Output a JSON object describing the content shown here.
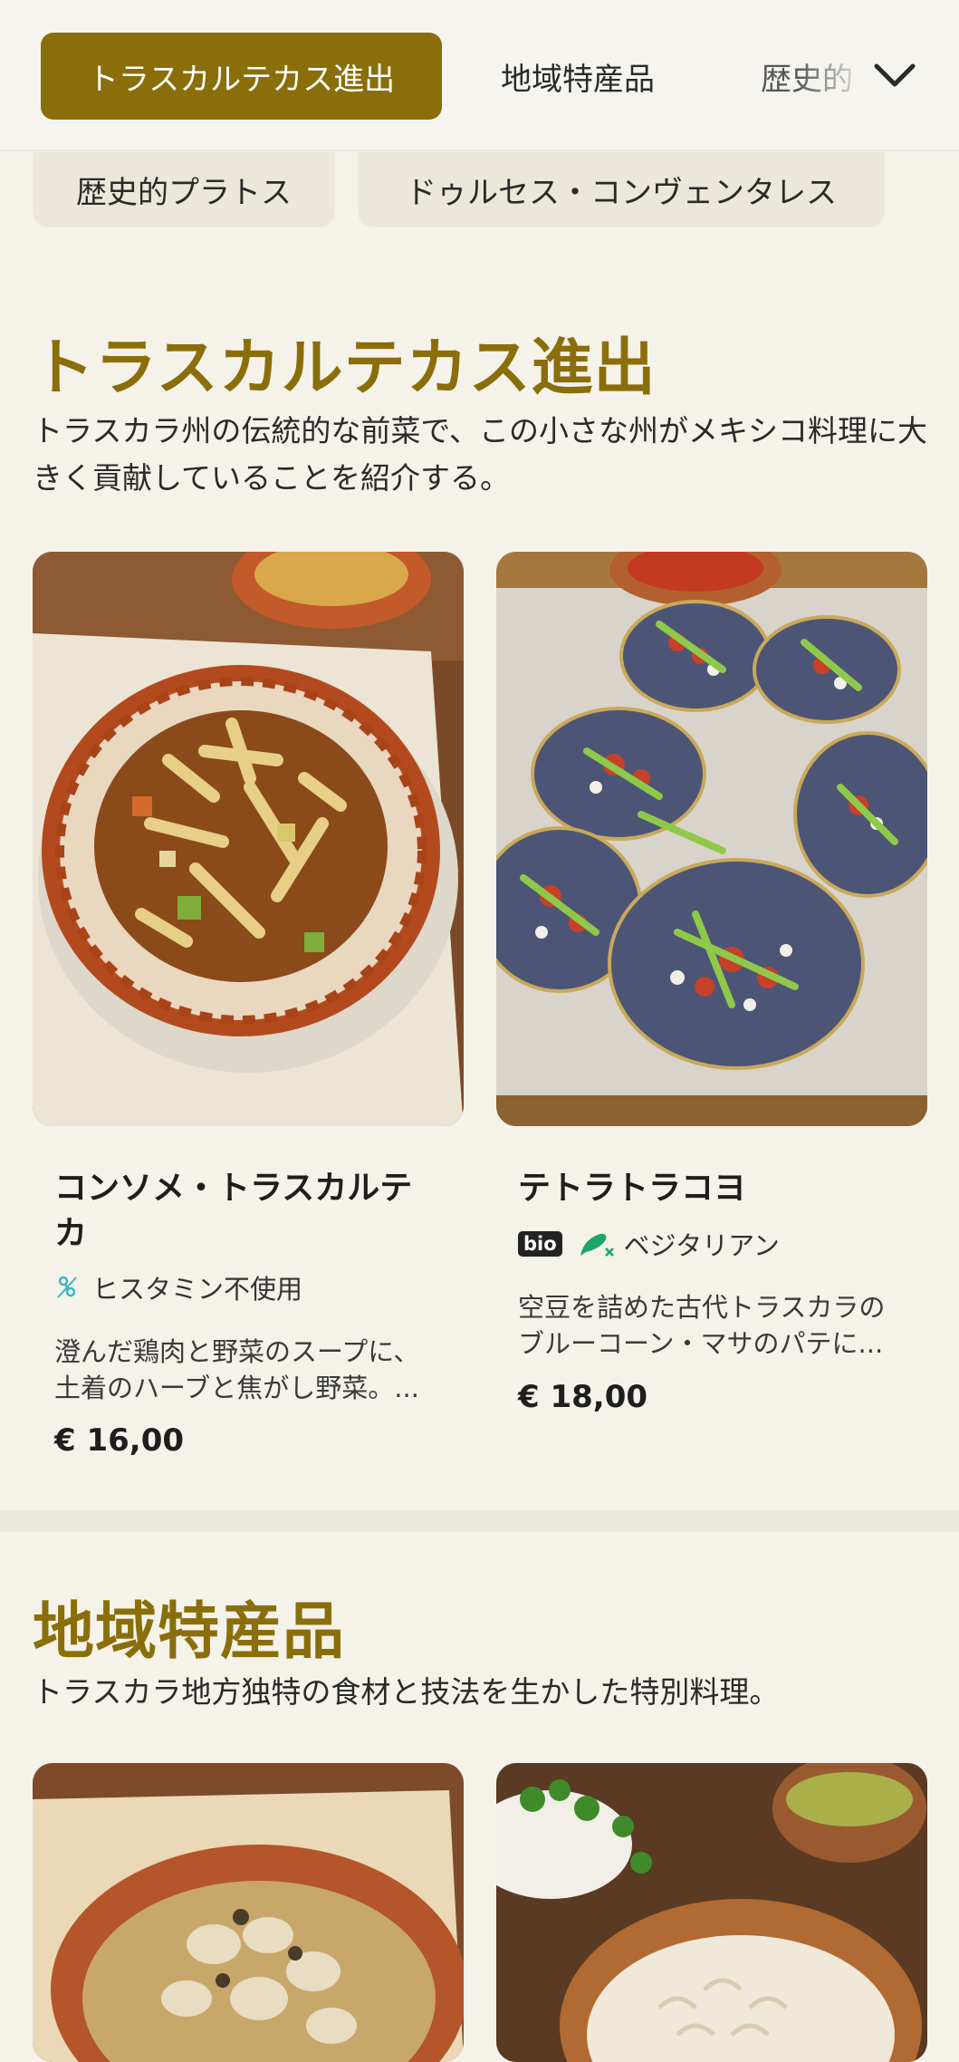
{
  "nav": {
    "tabs": [
      "トラスカルテカス進出",
      "地域特産品",
      "歴史的"
    ],
    "chips": [
      "歴史的プラトス",
      "ドゥルセス・コンヴェンタレス"
    ],
    "active_color": "#8a6e0a"
  },
  "sections": [
    {
      "title": "トラスカルテカス進出",
      "description": "トラスカラ州の伝統的な前菜で、この小さな州がメキシコ料理に大きく貢献していることを紹介する。",
      "items": [
        {
          "name": "コンソメ・トラスカルテカ",
          "tag": "ヒスタミン不使用",
          "description": "澄んだ鶏肉と野菜のスープに、土着のハーブと焦がし野菜。...",
          "price": "€ 16,00"
        },
        {
          "name": "テトラトラコヨ",
          "badge": "bio",
          "tag": "ベジタリアン",
          "description": "空豆を詰めた古代トラスカラのブルーコーン・マサのパテに...",
          "price": "€ 18,00"
        }
      ]
    },
    {
      "title": "地域特産品",
      "description": "トラスカラ地方独特の食材と技法を生かした特別料理。"
    }
  ]
}
